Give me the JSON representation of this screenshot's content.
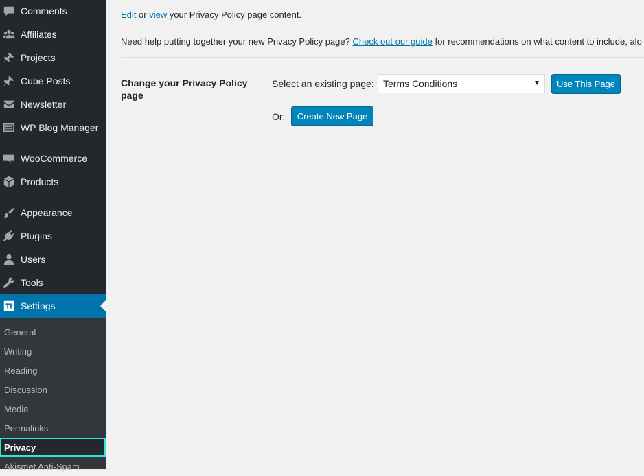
{
  "sidebar": {
    "items": [
      {
        "label": "Comments",
        "icon": "comment-icon"
      },
      {
        "label": "Affiliates",
        "icon": "groups-icon"
      },
      {
        "label": "Projects",
        "icon": "pushpin-icon"
      },
      {
        "label": "Cube Posts",
        "icon": "pushpin-icon"
      },
      {
        "label": "Newsletter",
        "icon": "envelope-icon"
      },
      {
        "label": "WP Blog Manager",
        "icon": "blog-icon"
      },
      {
        "label": "WooCommerce",
        "icon": "woo-icon"
      },
      {
        "label": "Products",
        "icon": "box-icon"
      },
      {
        "label": "Appearance",
        "icon": "brush-icon"
      },
      {
        "label": "Plugins",
        "icon": "plug-icon"
      },
      {
        "label": "Users",
        "icon": "user-icon"
      },
      {
        "label": "Tools",
        "icon": "wrench-icon"
      },
      {
        "label": "Settings",
        "icon": "settings-icon"
      }
    ],
    "submenu": [
      "General",
      "Writing",
      "Reading",
      "Discussion",
      "Media",
      "Permalinks",
      "Privacy",
      "Akismet Anti-Spam"
    ],
    "current_item": "Settings",
    "current_subitem": "Privacy"
  },
  "main": {
    "edit_link": "Edit",
    "or_text": " or ",
    "view_link": "view",
    "line1_rest": " your Privacy Policy page content.",
    "help_prefix": "Need help putting together your new Privacy Policy page? ",
    "guide_link": "Check out our guide",
    "help_suffix": " for recommendations on what content to include, alo",
    "row_heading": "Change your Privacy Policy page",
    "select_label": "Select an existing page:",
    "select_value": "Terms Conditions",
    "use_button": "Use This Page",
    "or_label": "Or:",
    "create_button": "Create New Page"
  },
  "colors": {
    "sidebar_bg": "#23282d",
    "submenu_bg": "#32373c",
    "accent": "#0073aa",
    "button": "#0085ba",
    "focus_outline": "#2ee6d6",
    "page_bg": "#f1f1f1"
  }
}
